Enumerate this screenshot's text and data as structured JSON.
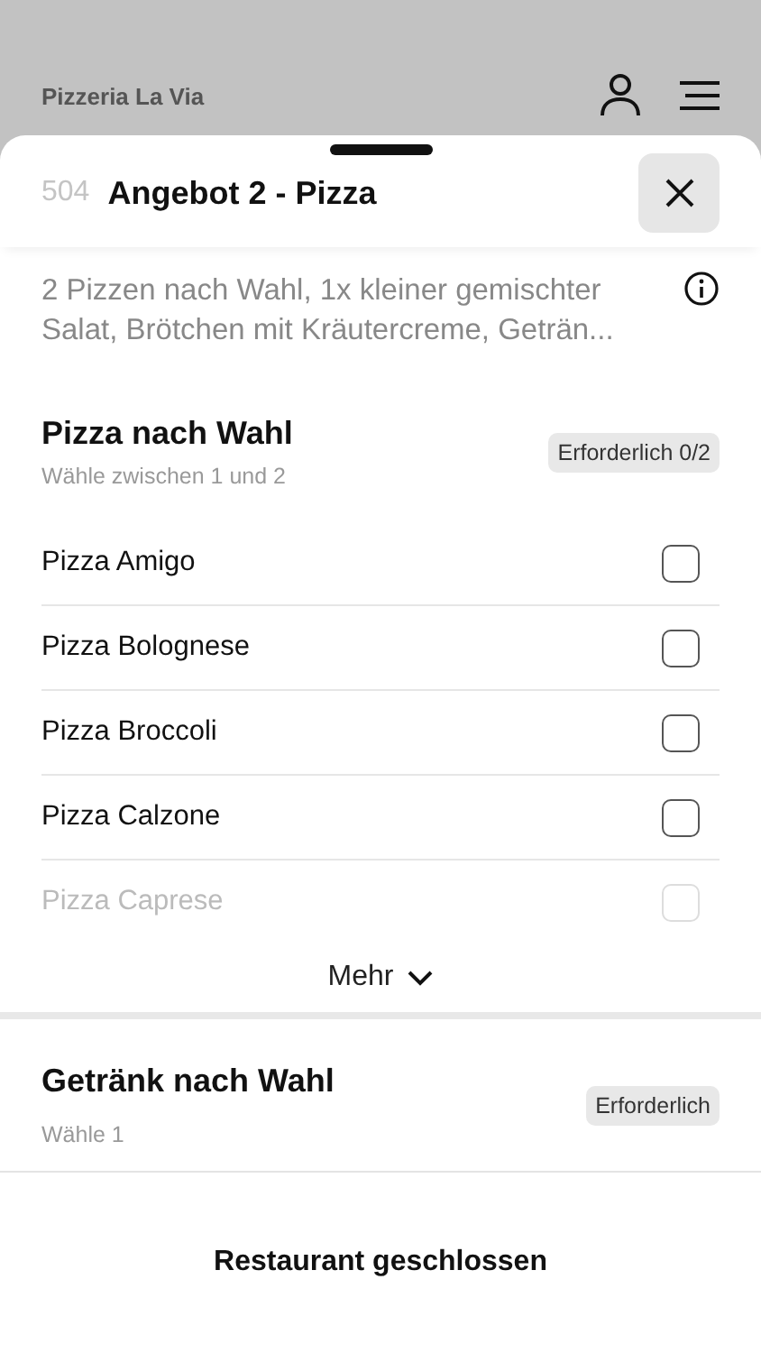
{
  "app_bar": {
    "title": "Pizzeria La Via"
  },
  "sheet": {
    "number": "504",
    "title": "Angebot 2 - Pizza",
    "description": "2 Pizzen nach Wahl, 1x kleiner gemischter Salat, Brötchen mit Kräutercreme, Geträn..."
  },
  "groups": [
    {
      "title": "Pizza nach Wahl",
      "hint": "Wähle zwischen 1 und 2",
      "badge": "Erforderlich 0/2",
      "kind": "checkbox",
      "more": "Mehr",
      "options": [
        {
          "label": "Pizza Amigo",
          "checked": false,
          "faded": false
        },
        {
          "label": "Pizza Bolognese",
          "checked": false,
          "faded": false
        },
        {
          "label": "Pizza Broccoli",
          "checked": false,
          "faded": false
        },
        {
          "label": "Pizza Calzone",
          "checked": false,
          "faded": false
        },
        {
          "label": "Pizza Caprese",
          "checked": false,
          "faded": true
        }
      ]
    },
    {
      "title": "Getränk nach Wahl",
      "hint": "Wähle 1",
      "badge": "Erforderlich",
      "kind": "radio"
    }
  ],
  "footer": {
    "status": "Restaurant geschlossen"
  }
}
